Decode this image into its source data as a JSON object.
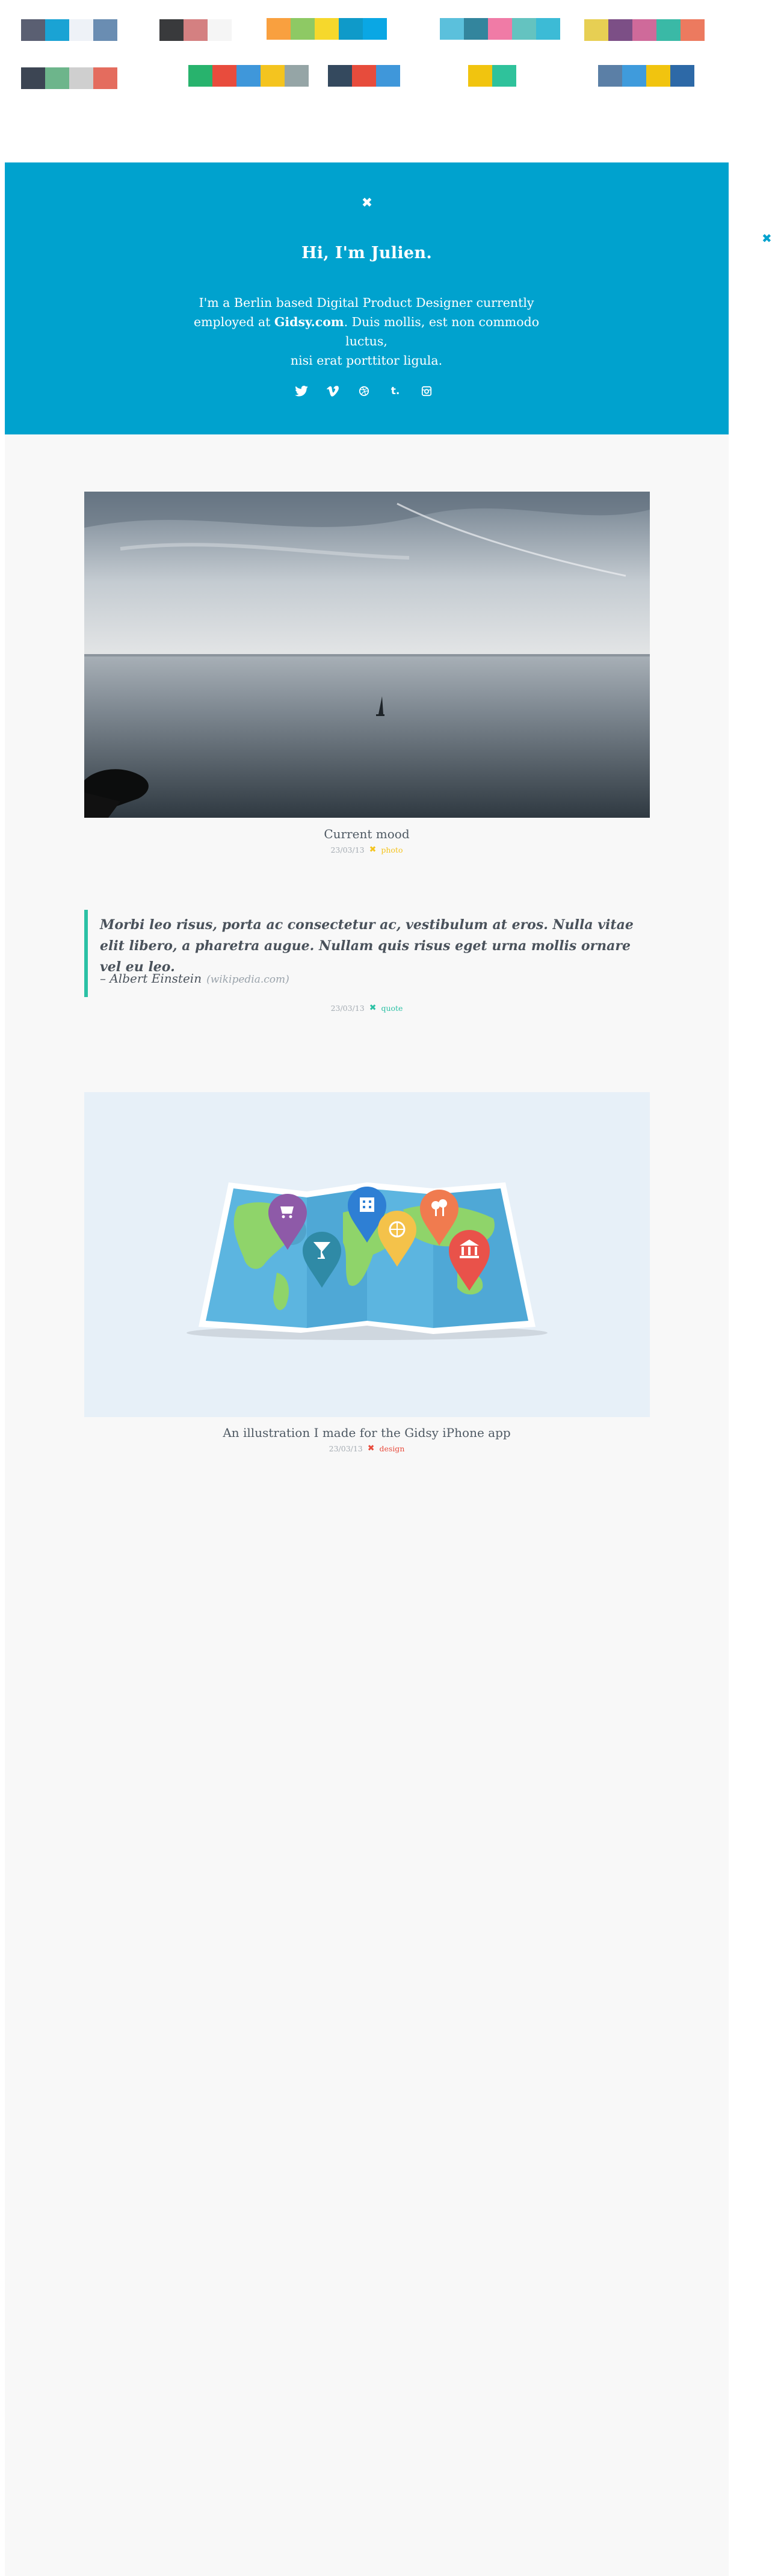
{
  "palettes": [
    [
      "#5a5f72",
      "#1aa3d4",
      "#eef2f7",
      "#6a8db2"
    ],
    [
      "#393a3c",
      "#d48081",
      "#f5f5f5"
    ],
    [
      "#f9a03f",
      "#8ec964",
      "#f6d82c",
      "#0f9ac9",
      "#0aa7e4"
    ],
    [
      "#5bc0dc",
      "#33859d",
      "#f07ba6",
      "#64c3c0",
      "#3cbbd6"
    ],
    [
      "#e7cf53",
      "#7c4f86",
      "#cf6a9a",
      "#3ab9a6",
      "#ec7a5f"
    ],
    [
      "#3c4553",
      "#6db58b",
      "#cfcfcf",
      "#e46c5e"
    ],
    [
      "#28b36d",
      "#e84c3d",
      "#3f97da",
      "#f4c41f",
      "#95a5a6"
    ],
    [
      "#34495e",
      "#e74c3c",
      "#3f97da"
    ],
    [
      "#f1c40f",
      "#2fc29b"
    ],
    [
      "#5b7fa6",
      "#3f9bdc",
      "#f1c40f",
      "#2d69a7"
    ]
  ],
  "hero": {
    "close_label": "✖",
    "greeting": "Hi, I'm Julien.",
    "bio_line1": "I'm a Berlin based Digital Product Designer currently",
    "bio_pre": "employed at ",
    "bio_company": "Gidsy.com",
    "bio_post": ". Duis mollis, est non commodo luctus,",
    "bio_line3": "nisi erat porttitor ligula.",
    "socials": [
      "twitter-icon",
      "vimeo-icon",
      "dribbble-icon",
      "tumblr-icon",
      "instagram-icon"
    ],
    "tumblr_glyph": "t."
  },
  "side_close": "✖",
  "posts": {
    "photo": {
      "caption": "Current mood",
      "date": "23/03/13",
      "icon": "✖",
      "category": "photo",
      "accent": "#f4c41f"
    },
    "quote": {
      "text": "Morbi leo risus, porta ac consectetur ac, vestibulum at eros. Nulla vitae elit libero, a pharetra augue. Nullam quis risus eget urna mollis ornare vel eu leo.",
      "author": "– Albert Einstein",
      "source": "(wikipedia.com)",
      "date": "23/03/13",
      "icon": "✖",
      "category": "quote",
      "accent": "#2cc1a5"
    },
    "design": {
      "caption": "An illustration I made for the Gidsy iPhone app",
      "date": "23/03/13",
      "icon": "✖",
      "category": "design",
      "accent": "#e84c3d"
    }
  }
}
